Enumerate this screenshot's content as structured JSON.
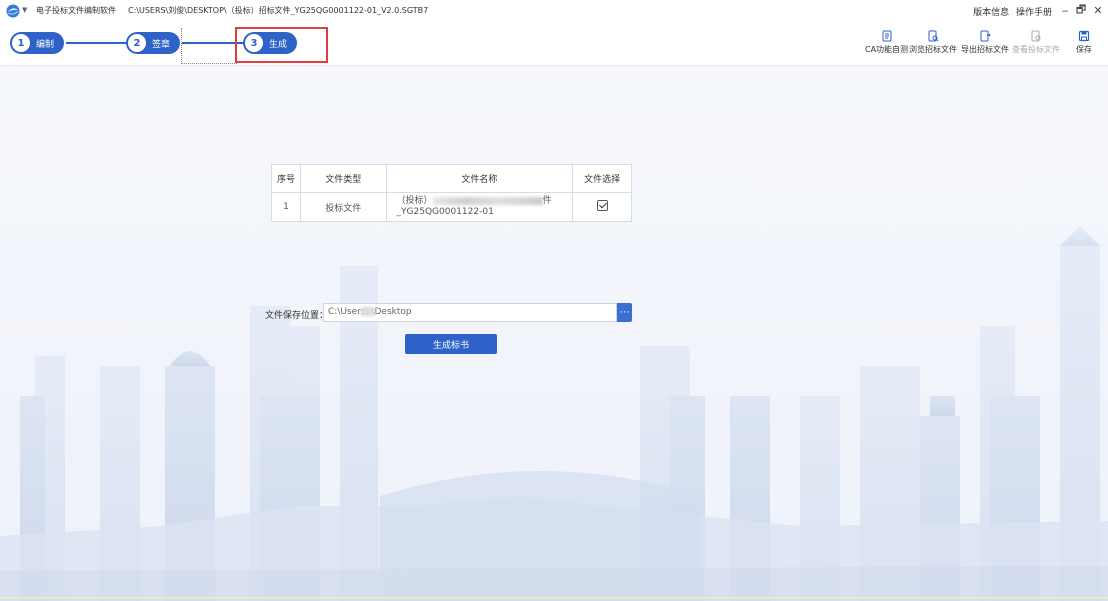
{
  "titlebar": {
    "app_name": "电子投标文件编制软件",
    "file_path": "C:\\USERS\\刘俊\\DESKTOP\\（投标）招标文件_YG25QG0001122-01_V2.0.SGTB7",
    "version_info": "版本信息",
    "manual": "操作手册",
    "minimize": "‒",
    "restore": "🗗",
    "close": "✕"
  },
  "steps": [
    {
      "num": "1",
      "label": "编制"
    },
    {
      "num": "2",
      "label": "签章"
    },
    {
      "num": "3",
      "label": "生成"
    }
  ],
  "tools": {
    "ca_check": "CA功能自测",
    "browse_bid": "浏览招标文件",
    "export_bid": "导出招标文件",
    "view_tender": "查看投标文件",
    "save": "保存"
  },
  "table": {
    "headers": [
      "序号",
      "文件类型",
      "文件名称",
      "文件选择"
    ],
    "rows": [
      {
        "no": "1",
        "type": "投标文件",
        "name_line1_prefix": "（投标）",
        "name_line1_suffix": "件",
        "name_line2": "_YG25QG0001122-01",
        "selected": true
      }
    ]
  },
  "save": {
    "label": "文件保存位置：",
    "value": "C:\\Users\\      \\Desktop",
    "browse": "⋯",
    "generate": "生成标书"
  },
  "colors": {
    "accent": "#2e62c9",
    "highlight": "#e13b3b"
  }
}
